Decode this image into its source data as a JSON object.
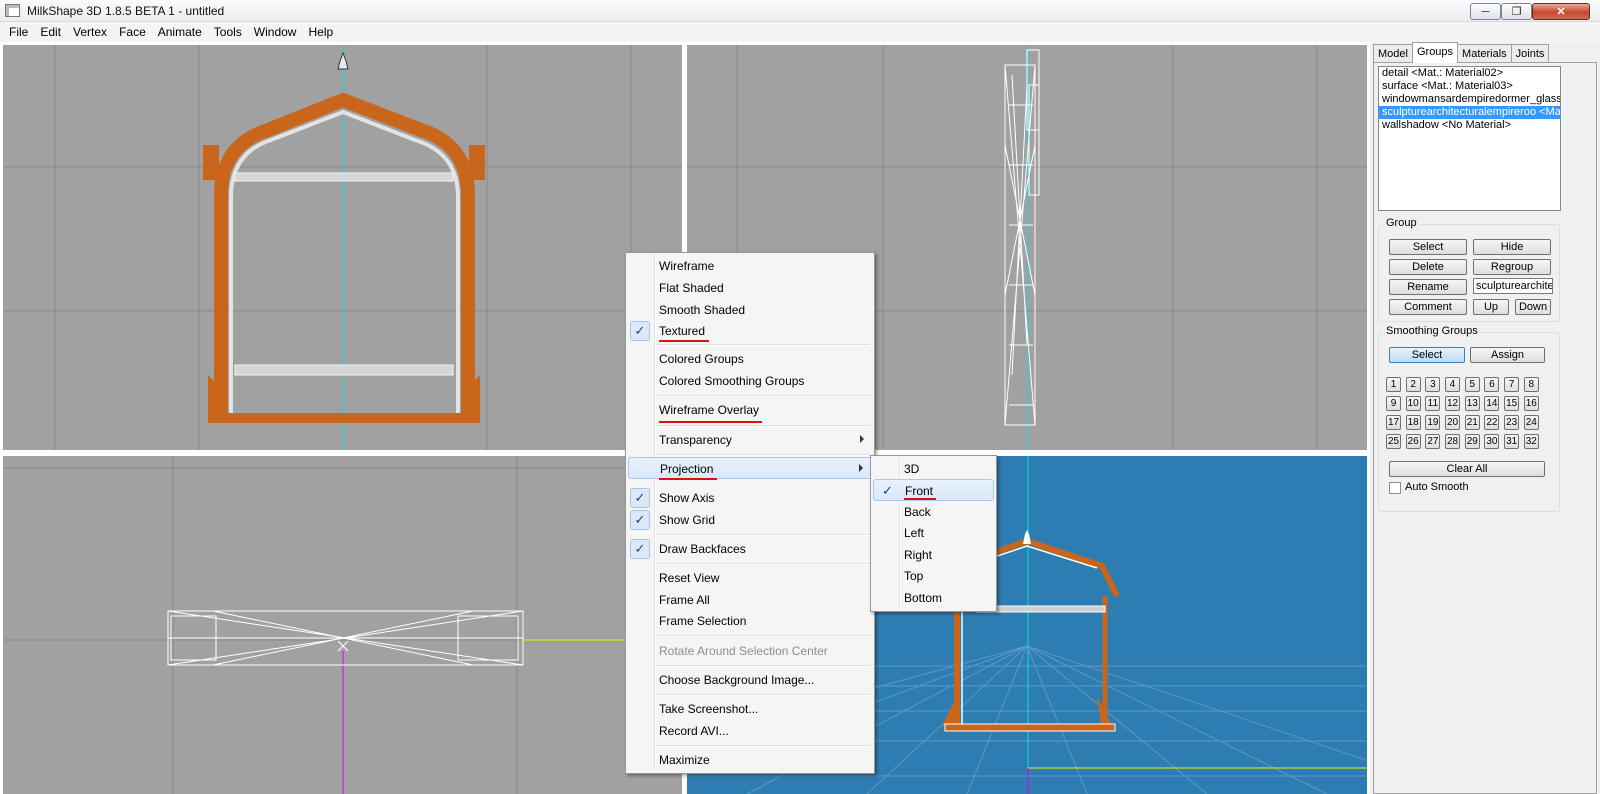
{
  "window": {
    "title": "MilkShape 3D 1.8.5 BETA 1 - untitled",
    "min": "─",
    "max": "❐",
    "close": "✕"
  },
  "menubar": [
    "File",
    "Edit",
    "Vertex",
    "Face",
    "Animate",
    "Tools",
    "Window",
    "Help"
  ],
  "context_menu": {
    "items": [
      {
        "label": "Wireframe",
        "checked": false
      },
      {
        "label": "Flat Shaded",
        "checked": false
      },
      {
        "label": "Smooth Shaded",
        "checked": false
      },
      {
        "label": "Textured",
        "checked": true
      },
      {
        "label": "Colored Groups",
        "checked": false
      },
      {
        "label": "Colored Smoothing Groups",
        "checked": false
      },
      {
        "label": "Wireframe Overlay",
        "checked": false
      },
      {
        "label": "Transparency",
        "submenu": true
      },
      {
        "label": "Projection",
        "submenu": true,
        "highlighted": true
      },
      {
        "label": "Show Axis",
        "checked": true
      },
      {
        "label": "Show Grid",
        "checked": true
      },
      {
        "label": "Draw Backfaces",
        "checked": true
      },
      {
        "label": "Reset View"
      },
      {
        "label": "Frame All"
      },
      {
        "label": "Frame Selection"
      },
      {
        "label": "Rotate Around Selection Center",
        "disabled": true
      },
      {
        "label": "Choose Background Image..."
      },
      {
        "label": "Take Screenshot..."
      },
      {
        "label": "Record AVI..."
      },
      {
        "label": "Maximize"
      }
    ],
    "check_glyph": "✓"
  },
  "projection_submenu": {
    "items": [
      "3D",
      "Front",
      "Back",
      "Left",
      "Right",
      "Top",
      "Bottom"
    ],
    "selected": "Front"
  },
  "panel": {
    "tabs": [
      "Model",
      "Groups",
      "Materials",
      "Joints"
    ],
    "active_tab": "Groups",
    "groups": [
      "detail <Mat.: Material02>",
      "surface <Mat.: Material03>",
      "windowmansardempiredormer_glass <N",
      "sculpturearchitecturalempireroo <Mat..",
      "wallshadow <No Material>"
    ],
    "selected_group_index": 3,
    "group_section": {
      "title": "Group",
      "select": "Select",
      "hide": "Hide",
      "delete": "Delete",
      "regroup": "Regroup",
      "rename": "Rename",
      "name_value": "sculpturearchite",
      "comment": "Comment",
      "up": "Up",
      "down": "Down"
    },
    "smoothing_section": {
      "title": "Smoothing Groups",
      "select": "Select",
      "assign": "Assign",
      "numbers": [
        "1",
        "2",
        "3",
        "4",
        "5",
        "6",
        "7",
        "8",
        "9",
        "10",
        "11",
        "12",
        "13",
        "14",
        "15",
        "16",
        "17",
        "18",
        "19",
        "20",
        "21",
        "22",
        "23",
        "24",
        "25",
        "26",
        "27",
        "28",
        "29",
        "30",
        "31",
        "32"
      ],
      "clear_all": "Clear All",
      "auto_smooth": "Auto Smooth",
      "auto_smooth_checked": false
    }
  },
  "colors": {
    "viewport_bg": "#a1a1a1",
    "viewport_3d_bg": "#2e7db2",
    "frame_wood": "#c9661c",
    "axis_cyan": "#00e0e0",
    "axis_yellow": "#f0f000",
    "axis_magenta": "#e000e0",
    "highlight": "#3399ff",
    "annotation_red": "#e01010"
  }
}
